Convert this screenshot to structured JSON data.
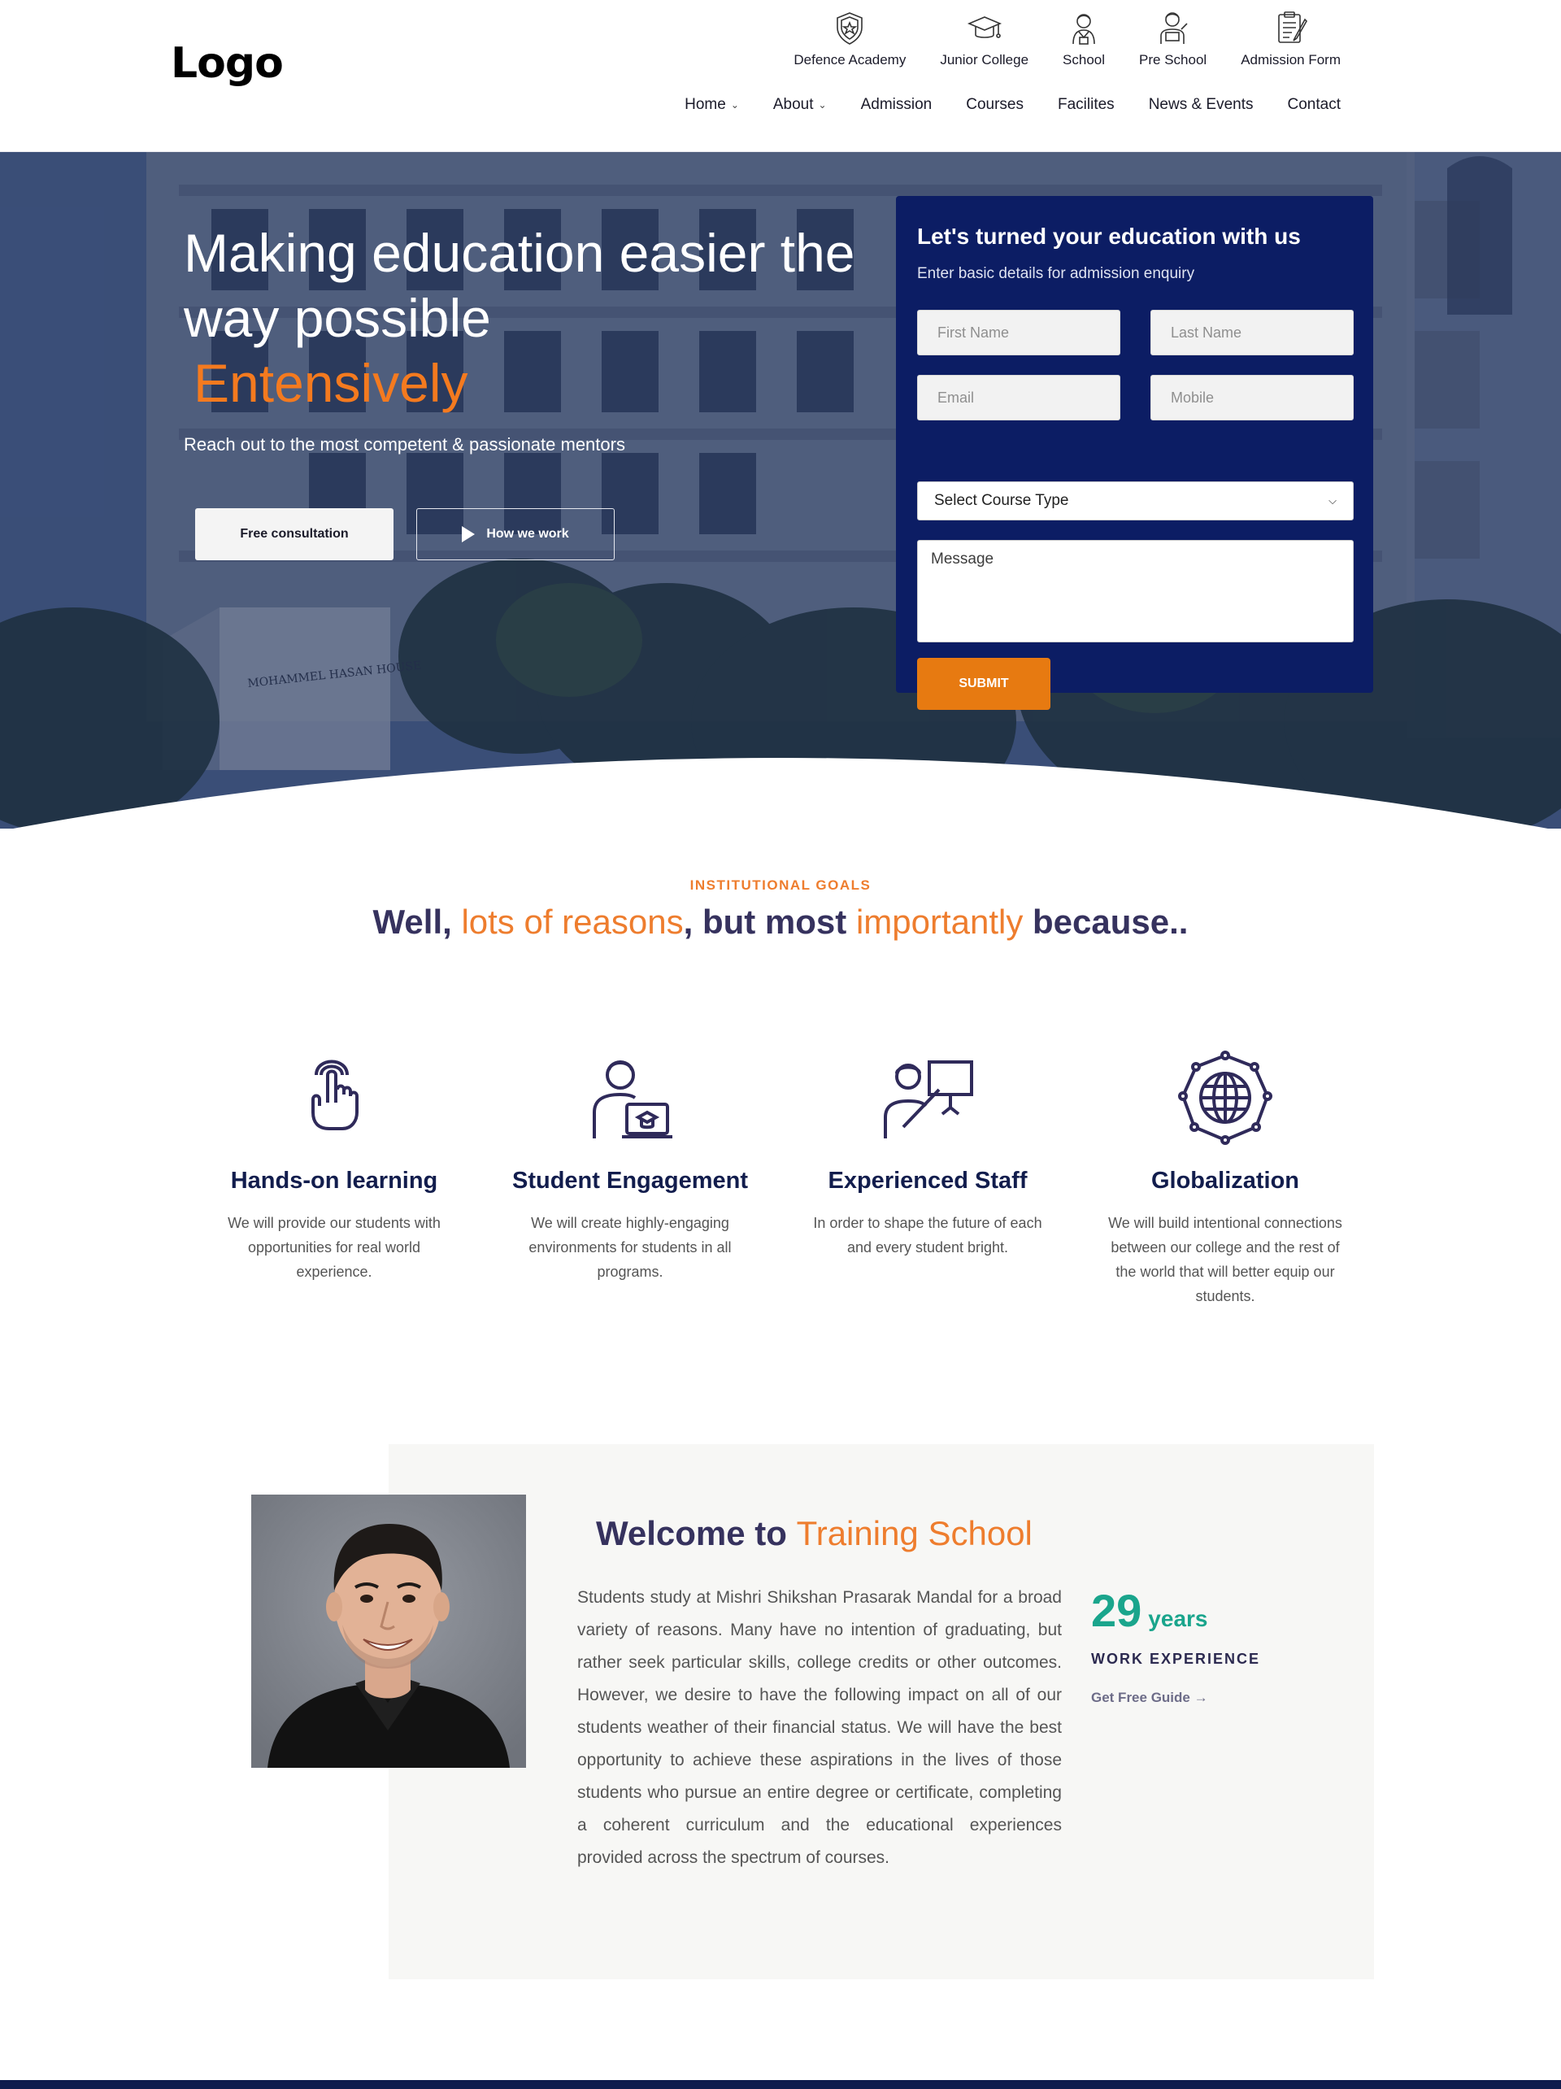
{
  "header": {
    "logo": "Logo",
    "top_links": [
      {
        "label": "Defence Academy",
        "icon": "shield-icon"
      },
      {
        "label": "Junior College",
        "icon": "graduation-cap-icon"
      },
      {
        "label": "School",
        "icon": "student-icon"
      },
      {
        "label": "Pre School",
        "icon": "child-icon"
      },
      {
        "label": "Admission Form",
        "icon": "form-icon"
      }
    ],
    "nav": [
      {
        "label": "Home",
        "dropdown": true
      },
      {
        "label": "About",
        "dropdown": true
      },
      {
        "label": "Admission",
        "dropdown": false
      },
      {
        "label": "Courses",
        "dropdown": false
      },
      {
        "label": "Facilites",
        "dropdown": false
      },
      {
        "label": "News & Events",
        "dropdown": false
      },
      {
        "label": "Contact",
        "dropdown": false
      }
    ]
  },
  "hero": {
    "title": "Making education easier the way possible",
    "accent": "Entensively",
    "subtitle": "Reach out to the most competent & passionate mentors",
    "btn_consult": "Free consultation",
    "btn_how": "How we work",
    "building_sign": "MOHAMMEL HASAN HOUSE"
  },
  "form": {
    "title": "Let's turned your education with us",
    "subtitle": "Enter basic details for admission enquiry",
    "first_name": "First Name",
    "last_name": "Last Name",
    "email": "Email",
    "mobile": "Mobile",
    "course_type": "Select Course Type",
    "message": "Message",
    "submit": "SUBMIT"
  },
  "goals": {
    "eyebrow": "INSTITUTIONAL GOALS",
    "title_1": "Well, ",
    "title_2": "lots of reasons",
    "title_3": ", but most ",
    "title_4": "importantly",
    "title_5": " because..",
    "features": [
      {
        "title": "Hands-on learning",
        "text": "We will provide our students with opportunities for real world experience.",
        "icon": "touch-hand-icon"
      },
      {
        "title": "Student Engagement",
        "text": "We will create highly-engaging environments for students in all programs.",
        "icon": "student-laptop-icon"
      },
      {
        "title": "Experienced Staff",
        "text": "In order to shape the future of each and every student bright.",
        "icon": "teacher-board-icon"
      },
      {
        "title": "Globalization",
        "text": "We will build intentional connections between our college and the rest of the world that will better equip our students.",
        "icon": "globe-network-icon"
      }
    ]
  },
  "welcome": {
    "title_1": "Welcome to ",
    "title_2": "Training School",
    "text": "Students study at Mishri Shikshan Prasarak Mandal for a broad variety of reasons. Many have no intention of graduating, but rather seek particular skills, college credits or other outcomes. However, we desire to have the following impact on all of our students weather of their financial status. We will have the best opportunity to achieve these aspirations in the lives of those students who pursue an entire degree or certificate, completing a coherent curriculum and the educational experiences provided across the spectrum of courses.",
    "years_num": "29",
    "years_unit": "years",
    "work_exp": "WORK EXPERIENCE",
    "guide": "Get Free Guide →"
  },
  "colors": {
    "navy": "#0c1d64",
    "orange": "#ee7d2e",
    "submit_orange": "#e77a11",
    "teal": "#1aa58c",
    "heading": "#36325e"
  }
}
